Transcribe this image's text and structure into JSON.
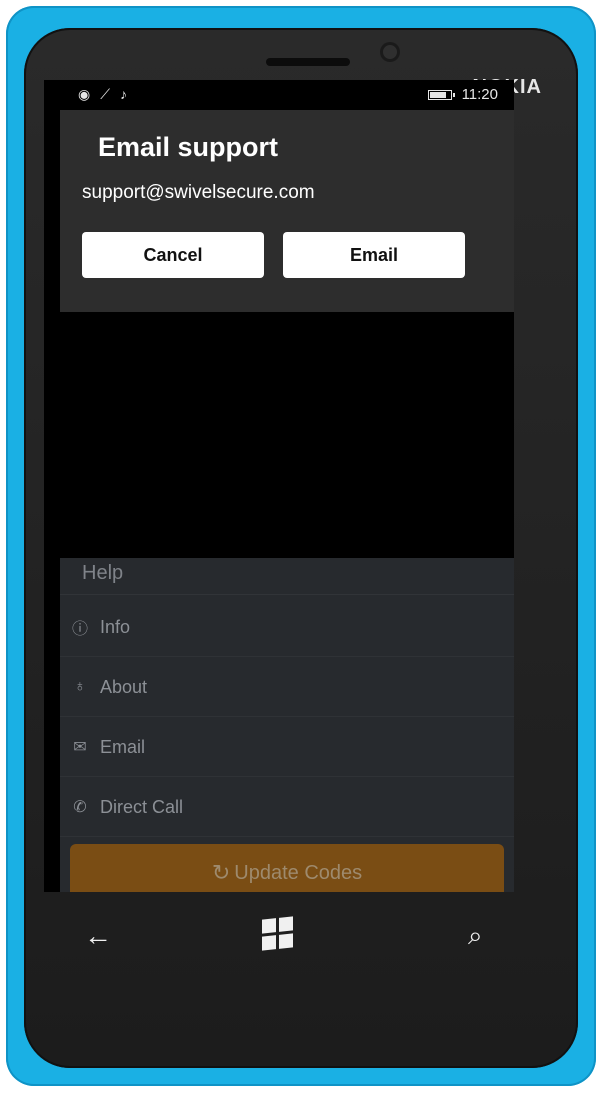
{
  "device": {
    "brand": "NOKIA"
  },
  "status_bar": {
    "left_icons": [
      "wifi-icon",
      "signal-icon",
      "quiet-hours-icon"
    ],
    "battery_level": 0.8,
    "time": "11:20"
  },
  "dialog": {
    "title": "Email support",
    "address": "support@swivelsecure.com",
    "cancel_label": "Cancel",
    "email_label": "Email"
  },
  "menu": {
    "header": "Help",
    "items": [
      {
        "icon": "info-icon",
        "label": "Info"
      },
      {
        "icon": "lightbulb-icon",
        "label": "About"
      },
      {
        "icon": "envelope-icon",
        "label": "Email"
      },
      {
        "icon": "phone-icon",
        "label": "Direct Call"
      }
    ]
  },
  "update_button": {
    "icon": "refresh-icon",
    "label": "Update Codes",
    "color": "#7a4d14"
  },
  "nav_bar": {
    "back_icon": "back-arrow-icon",
    "start_icon": "windows-icon",
    "search_icon": "search-icon"
  },
  "colors": {
    "device_body": "#1ab0e4",
    "dialog_bg": "#2d2d2d",
    "menu_bg": "#272a2e"
  }
}
